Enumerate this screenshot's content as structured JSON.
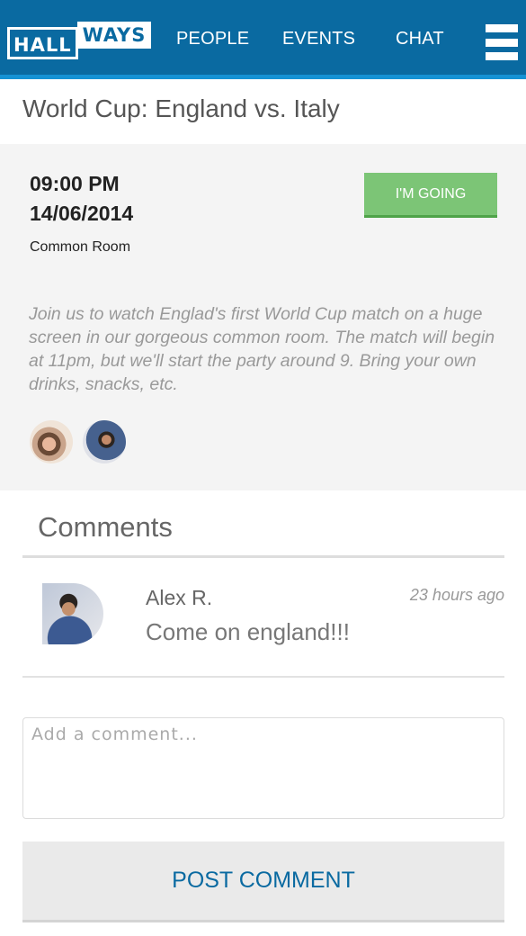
{
  "header": {
    "logo": {
      "part1": "HALL",
      "part2": "WAYS"
    },
    "nav": [
      {
        "label": "PEOPLE"
      },
      {
        "label": "EVENTS"
      },
      {
        "label": "CHAT"
      }
    ],
    "menu_icon": "hamburger-menu-icon",
    "background_color": "#0a6aa1"
  },
  "event": {
    "title": "World Cup: England vs. Italy",
    "time": "09:00 PM",
    "date": "14/06/2014",
    "location": "Common Room",
    "going_button_label": "I'M GOING",
    "going_button_color": "#7cc576",
    "description": "Join us to watch Englad's first World Cup match on a huge screen in our gorgeous common room. The match will begin at 11pm, but we'll start the party around 9. Bring your own drinks, snacks, etc.",
    "attendees": [
      {
        "icon": "attendee-avatar"
      },
      {
        "icon": "attendee-avatar"
      }
    ]
  },
  "comments": {
    "heading": "Comments",
    "items": [
      {
        "author": "Alex R.",
        "time": "23 hours ago",
        "text": "Come on england!!!"
      }
    ],
    "input_placeholder": "Add a comment...",
    "post_button_label": "POST COMMENT"
  }
}
